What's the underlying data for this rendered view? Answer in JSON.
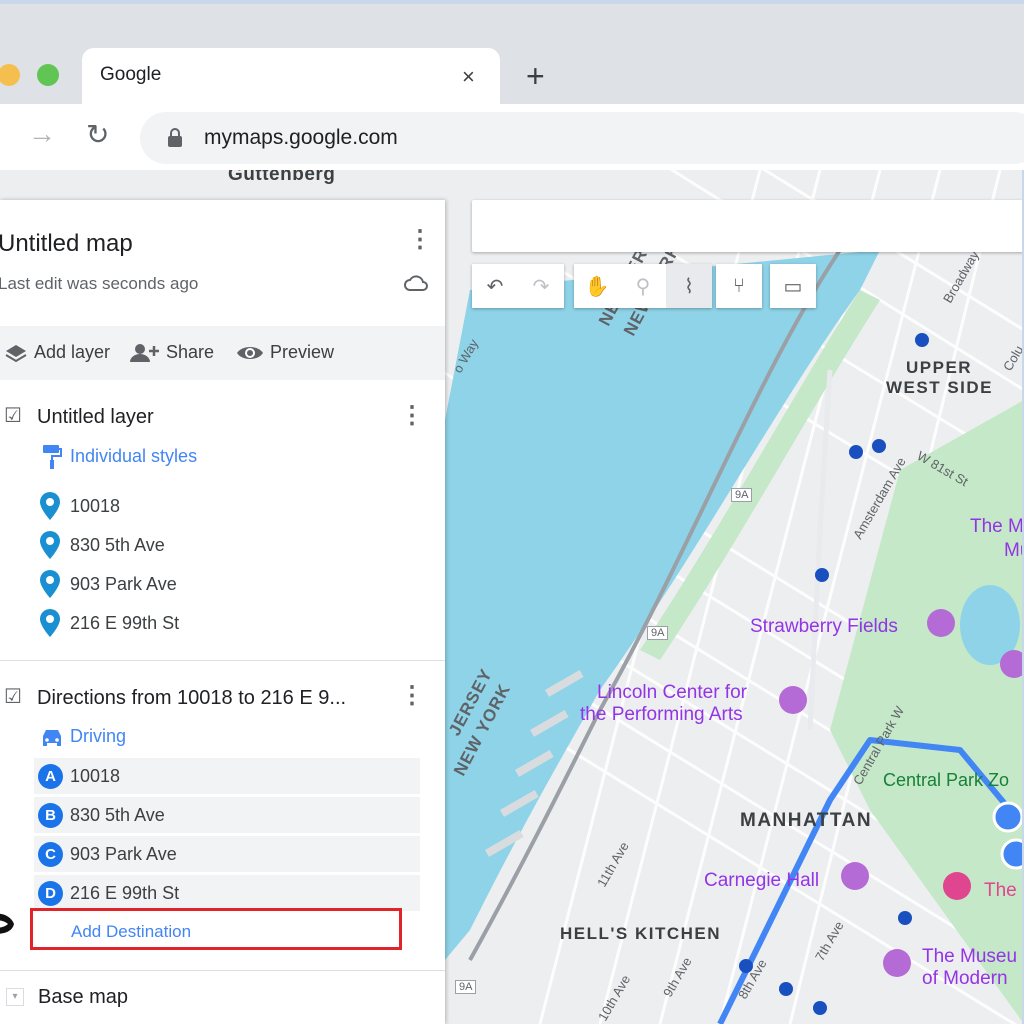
{
  "browser": {
    "tab_title": "Google",
    "tab_close": "×",
    "new_tab": "+",
    "url": "mymaps.google.com",
    "forward_glyph": "→",
    "reload_glyph": "↻"
  },
  "map": {
    "labels": {
      "guttenberg": "Guttenberg",
      "upper_west_1": "UPPER",
      "upper_west_2": "WEST SIDE",
      "manhattan": "MANHATTAN",
      "hells_kitchen": "HELL'S KITCHEN",
      "new_jersey_1": "NEW JERSEY",
      "new_jersey_2": "NEW YORK",
      "jersey_1": "JERSEY",
      "jersey_2": "NEW YORK",
      "strawberry_fields": "Strawberry Fields",
      "lincoln_1": "Lincoln Center for",
      "lincoln_2": "the Performing Arts",
      "central_park_zoo": "Central Park Zo",
      "carnegie_hall": "Carnegie Hall",
      "the_met_1": "The M",
      "the_met_2": "Mu",
      "museum_1": "The Museu",
      "museum_2": "of Modern",
      "the_t": "The T",
      "broadway": "Broadway",
      "amsterdam_ave": "Amsterdam Ave",
      "w81st": "W 81st St",
      "w_way": "o Way",
      "col": "Colu",
      "park_w": "Central Park W",
      "eleventh_ave": "11th Ave",
      "ninth_ave": "9th Ave",
      "tenth_ave": "10th Ave",
      "seventh_ave": "7th Ave",
      "eighth_ave": "8th Ave",
      "route_9a": "9A"
    },
    "tools": {
      "undo": "↶",
      "redo": "↷",
      "hand": "✋",
      "marker": "⚲",
      "line": "⌇",
      "directions": "⑂",
      "ruler": "▭"
    }
  },
  "panel": {
    "title": "Untitled map",
    "subtitle": "Last edit was seconds ago",
    "kebab": "⋮",
    "actions": {
      "add_layer": "Add layer",
      "share": "Share",
      "preview": "Preview"
    },
    "layer1": {
      "checkbox": "☑",
      "title": "Untitled layer",
      "style_link": "Individual styles",
      "places": [
        "10018",
        "830 5th Ave",
        "903 Park Ave",
        "216 E 99th St"
      ]
    },
    "layer2": {
      "checkbox": "☑",
      "title": "Directions from 10018 to 216 E 9...",
      "mode": "Driving",
      "stops": [
        {
          "letter": "A",
          "label": "10018"
        },
        {
          "letter": "B",
          "label": "830 5th Ave"
        },
        {
          "letter": "C",
          "label": "903 Park Ave"
        },
        {
          "letter": "D",
          "label": "216 E 99th St"
        }
      ],
      "add_destination": "Add Destination"
    },
    "base_map": {
      "arrow": "▾",
      "label": "Base map"
    }
  },
  "colors": {
    "water": "#8fd3e8",
    "park": "#c5e8c8",
    "route": "#4285f4",
    "accent_blue": "#1a73e8",
    "highlight_red": "#e0242a"
  }
}
